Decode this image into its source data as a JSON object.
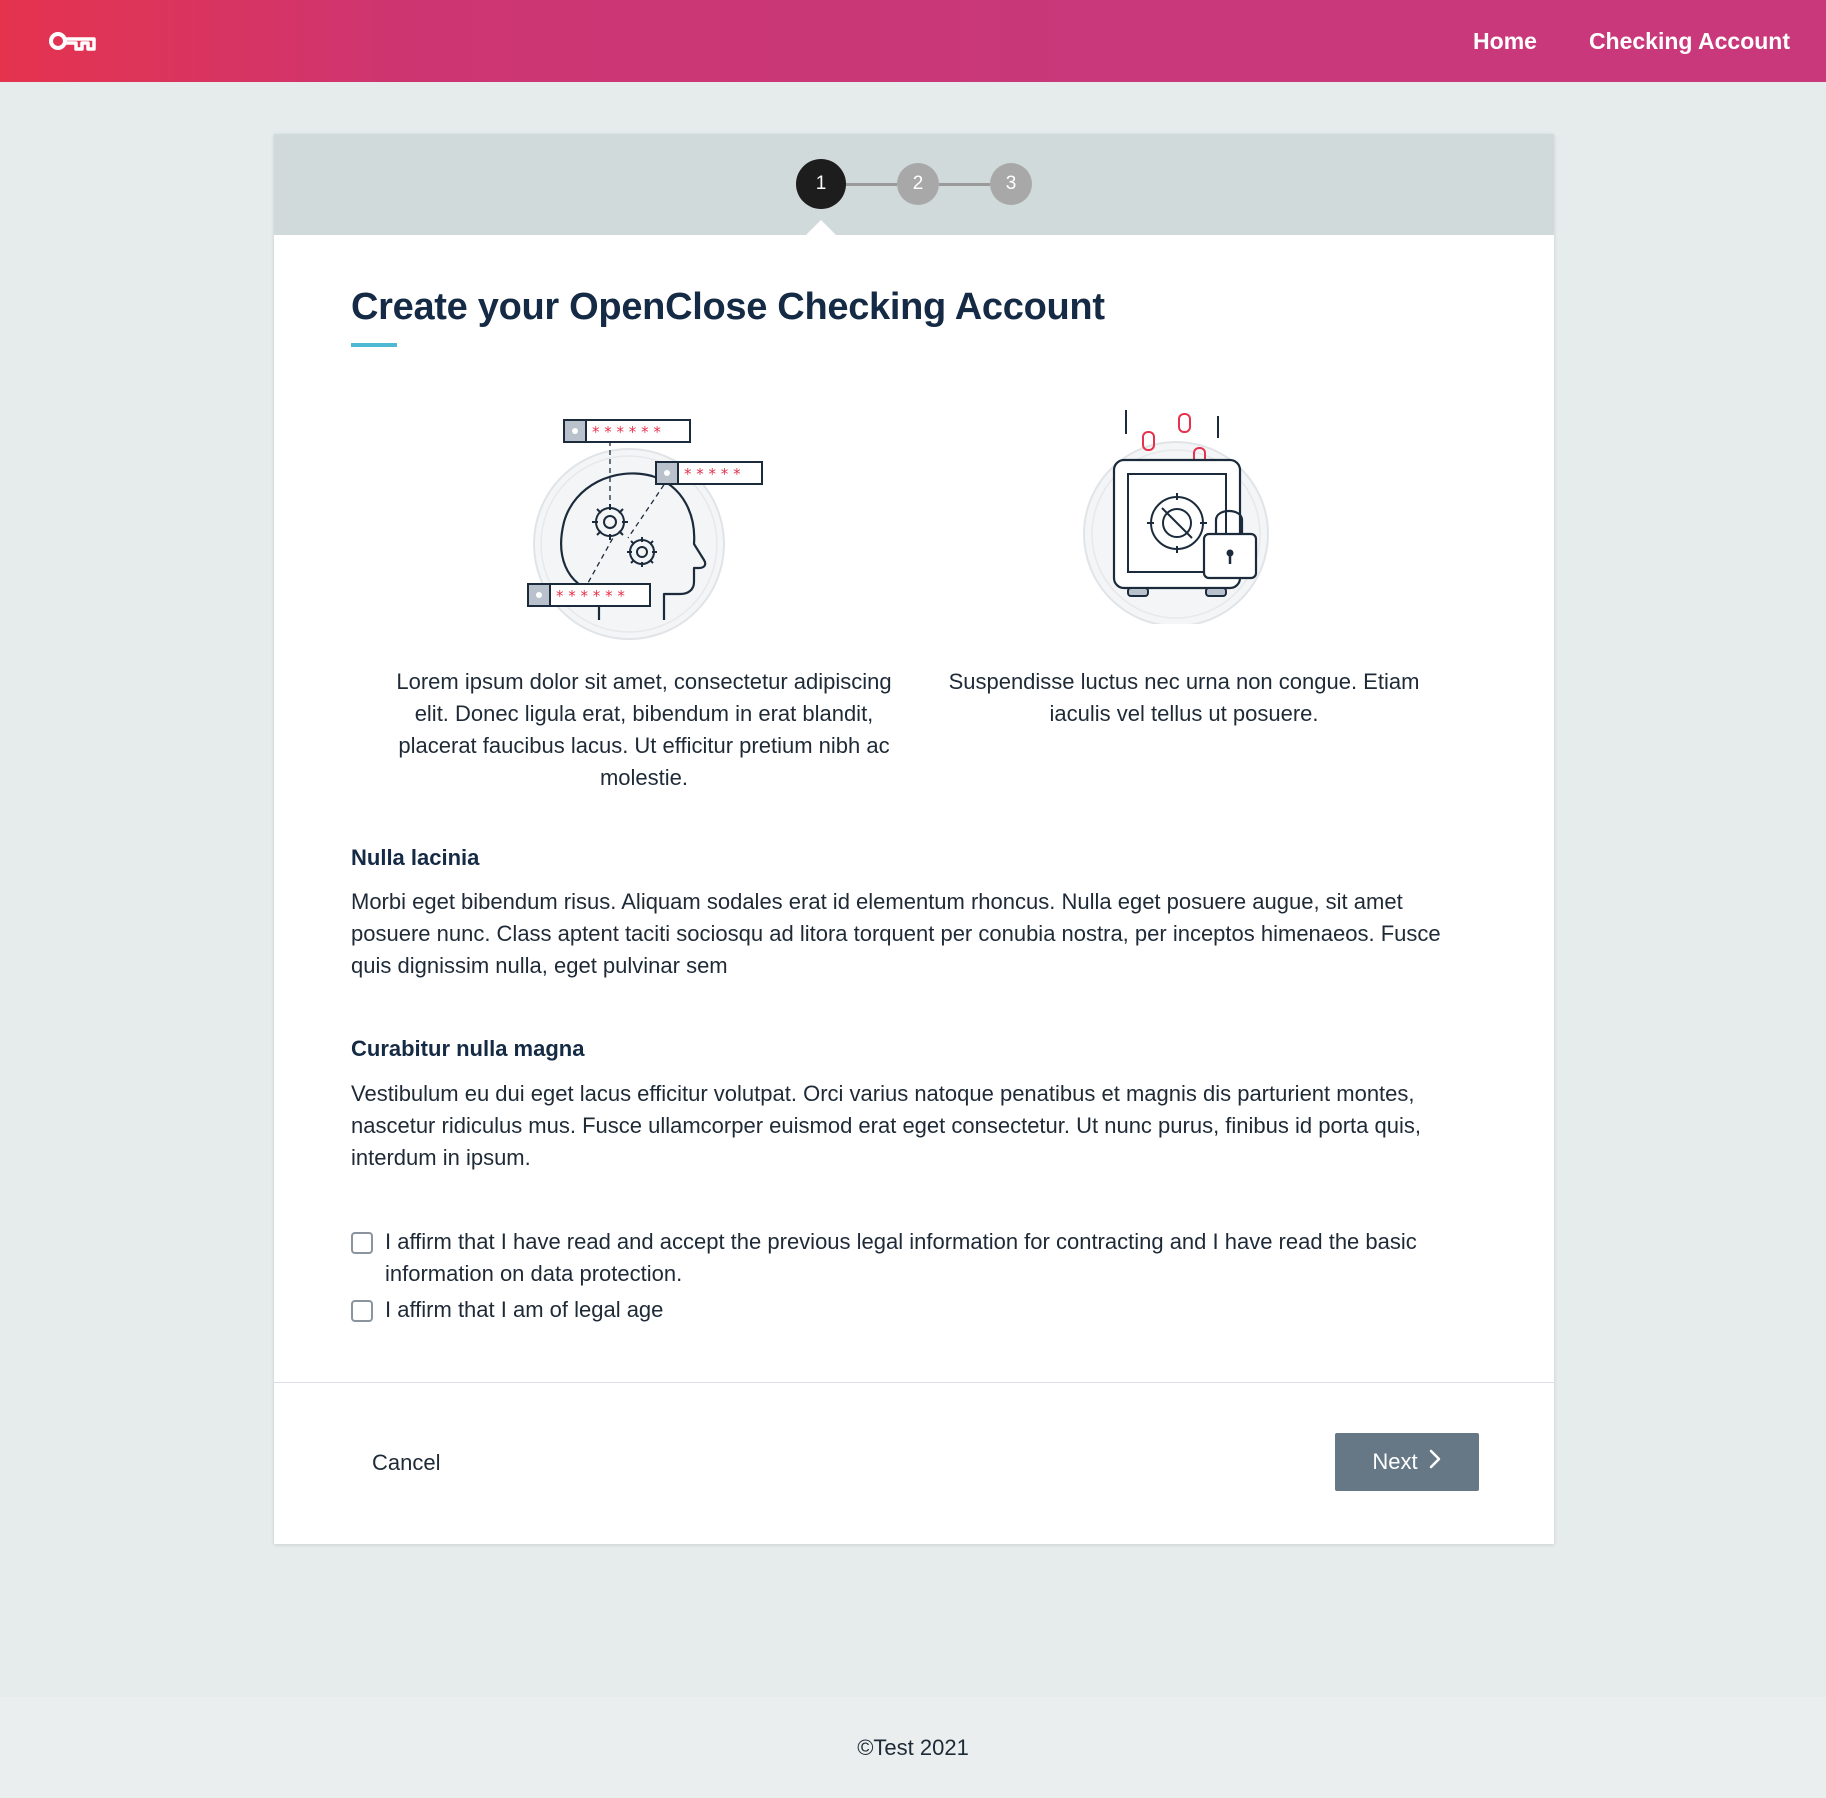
{
  "header": {
    "logo_icon": "key-icon",
    "nav": [
      {
        "label": "Home"
      },
      {
        "label": "Checking Account"
      }
    ],
    "gradient_start": "#e5334e",
    "gradient_end": "#c8387a"
  },
  "stepper": {
    "steps": [
      "1",
      "2",
      "3"
    ],
    "current": 1
  },
  "page": {
    "title": "Create your OpenClose Checking Account",
    "accent_color": "#4fb9d4"
  },
  "features": [
    {
      "icon": "head-gears-password-illustration",
      "text": "Lorem ipsum dolor sit amet, consectetur adipiscing elit. Donec ligula erat, bibendum in erat blandit, placerat faucibus lacus. Ut efficitur pretium nibh ac molestie."
    },
    {
      "icon": "safe-lock-illustration",
      "text": "Suspendisse luctus nec urna non congue. Etiam iaculis vel tellus ut posuere."
    }
  ],
  "sections": [
    {
      "heading": "Nulla lacinia",
      "body": "Morbi eget bibendum risus. Aliquam sodales erat id elementum rhoncus. Nulla eget posuere augue, sit amet posuere nunc. Class aptent taciti sociosqu ad litora torquent per conubia nostra, per inceptos himenaeos. Fusce quis dignissim nulla, eget pulvinar sem"
    },
    {
      "heading": "Curabitur nulla magna",
      "body": "Vestibulum eu dui eget lacus efficitur volutpat. Orci varius natoque penatibus et magnis dis parturient montes, nascetur ridiculus mus. Fusce ullamcorper euismod erat eget consectetur. Ut nunc purus, finibus id porta quis, interdum in ipsum."
    }
  ],
  "consents": [
    {
      "label": "I affirm that I have read and accept the previous legal information for contracting and I have read the basic information on data protection.",
      "checked": false
    },
    {
      "label": "I affirm that I am of legal age",
      "checked": false
    }
  ],
  "actions": {
    "cancel_label": "Cancel",
    "next_label": "Next",
    "next_icon": "chevron-right-icon",
    "next_color": "#667786"
  },
  "footer": {
    "text": "©Test 2021"
  }
}
